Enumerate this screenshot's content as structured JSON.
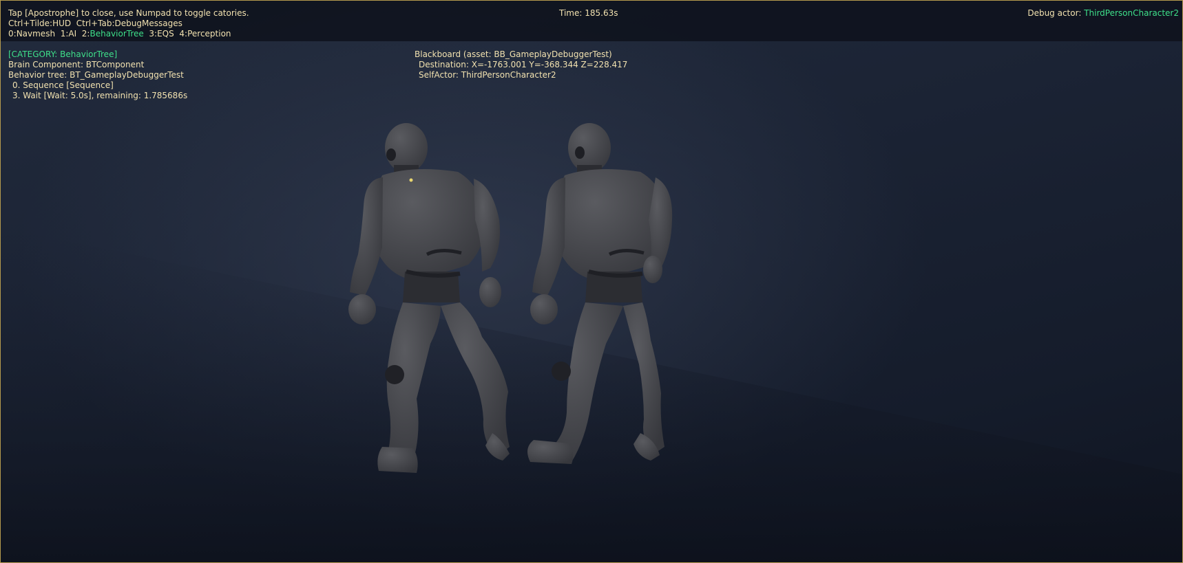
{
  "hud": {
    "help_line": "Tap [Apostrophe] to close, use Numpad to toggle catories.",
    "shortcut_hud_key": "Ctrl+Tilde:",
    "shortcut_hud_label": "HUD",
    "shortcut_msg_key": "Ctrl+Tab:",
    "shortcut_msg_label": "DebugMessages",
    "categories": [
      {
        "key": "0:",
        "label": "Navmesh",
        "active": false
      },
      {
        "key": "1:",
        "label": "AI",
        "active": false
      },
      {
        "key": "2:",
        "label": "BehaviorTree",
        "active": true
      },
      {
        "key": "3:",
        "label": "EQS",
        "active": false
      },
      {
        "key": "4:",
        "label": "Perception",
        "active": false
      }
    ],
    "time_label": "Time: 185.63s",
    "debug_actor_label": "Debug actor: ",
    "debug_actor_value": "ThirdPersonCharacter2"
  },
  "behavior_tree": {
    "category_header": "[CATEGORY: BehaviorTree]",
    "brain_component": "Brain Component: BTComponent",
    "behavior_tree": "Behavior tree: BT_GameplayDebuggerTest",
    "stack": [
      "0. Sequence [Sequence]",
      "3. Wait [Wait: 5.0s], remaining: 1.785686s"
    ]
  },
  "blackboard": {
    "header": "Blackboard (asset: BB_GameplayDebuggerTest)",
    "entries": [
      "Destination: X=-1763.001 Y=-368.344 Z=228.417",
      "SelfActor: ThirdPersonCharacter2"
    ]
  },
  "colors": {
    "hud_text": "#f2e2b0",
    "highlight": "#3ee08a",
    "border": "#b69b4e",
    "mannequin": "#4a4b50"
  }
}
